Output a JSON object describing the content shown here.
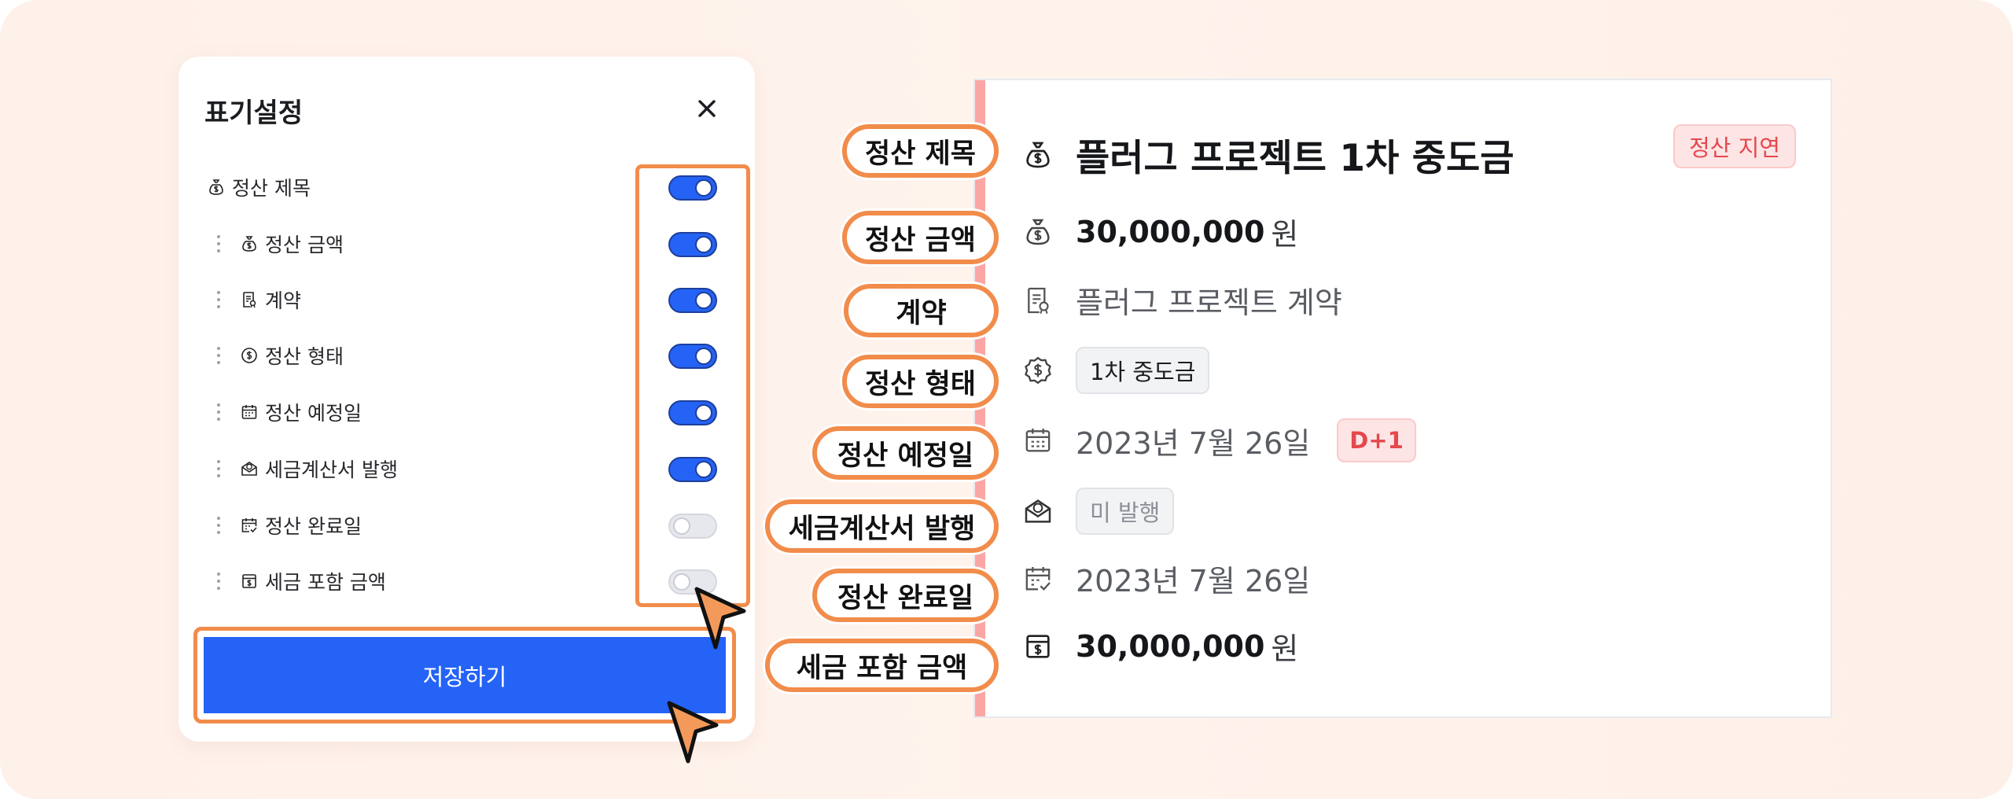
{
  "colors": {
    "accent_blue": "#2563f6",
    "highlight_orange": "#f18c4b",
    "danger_red": "#e5484d",
    "background_peach": "#fdf1ea"
  },
  "settings_panel": {
    "title": "표기설정",
    "close_icon": "close-icon",
    "save_label": "저장하기",
    "items": [
      {
        "label": "정산 제목",
        "icon": "money-bag-icon",
        "enabled": true
      },
      {
        "label": "정산 금액",
        "icon": "money-bag-icon",
        "enabled": true
      },
      {
        "label": "계약",
        "icon": "contract-icon",
        "enabled": true
      },
      {
        "label": "정산 형태",
        "icon": "dollar-circle-icon",
        "enabled": true
      },
      {
        "label": "정산 예정일",
        "icon": "calendar-icon",
        "enabled": true
      },
      {
        "label": "세금계산서 발행",
        "icon": "envelope-dollar-icon",
        "enabled": true
      },
      {
        "label": "정산 완료일",
        "icon": "calendar-check-icon",
        "enabled": false
      },
      {
        "label": "세금 포함 금액",
        "icon": "receipt-dollar-icon",
        "enabled": false
      }
    ]
  },
  "preview": {
    "title": "플러그 프로젝트 1차 중도금",
    "status_badge": "정산 지연",
    "amount": "30,000,000",
    "amount_unit": "원",
    "contract": "플러그 프로젝트 계약",
    "settlement_type": "1차 중도금",
    "due_date": "2023년 7월 26일",
    "due_badge": "D+1",
    "tax_invoice_status": "미 발행",
    "completed_date": "2023년 7월 26일",
    "tax_included_amount": "30,000,000",
    "tax_included_unit": "원"
  },
  "callouts": [
    "정산 제목",
    "정산 금액",
    "계약",
    "정산 형태",
    "정산 예정일",
    "세금계산서 발행",
    "정산 완료일",
    "세금 포함 금액"
  ]
}
